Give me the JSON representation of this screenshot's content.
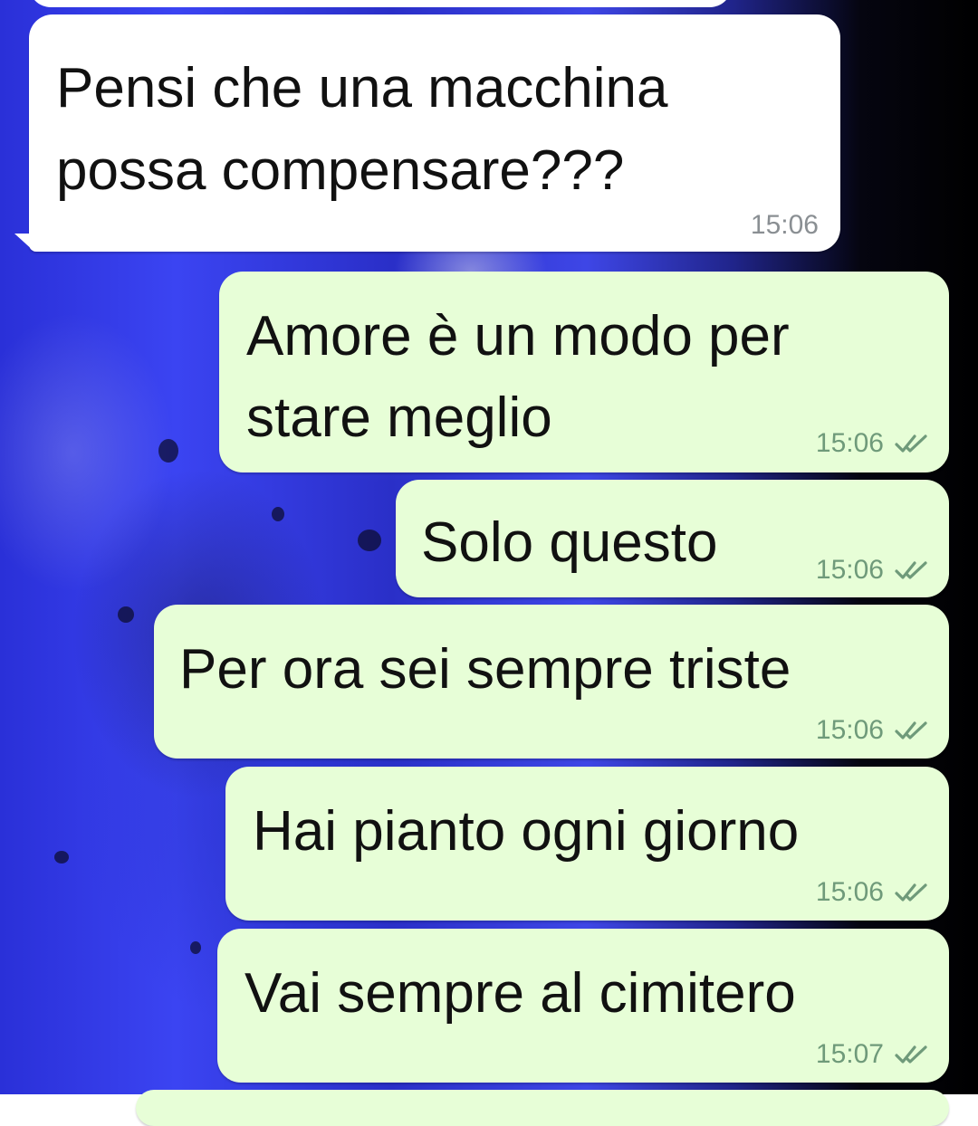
{
  "messages": [
    {
      "direction": "incoming",
      "lines": [
        "Pensi che una macchina",
        "possa compensare???"
      ],
      "time": "15:06",
      "status": null
    },
    {
      "direction": "outgoing",
      "lines": [
        "Amore è un modo per",
        "stare meglio"
      ],
      "time": "15:06",
      "status": "read-double-check-icon"
    },
    {
      "direction": "outgoing",
      "lines": [
        "Solo questo"
      ],
      "time": "15:06",
      "status": "read-double-check-icon"
    },
    {
      "direction": "outgoing",
      "lines": [
        "Per ora sei sempre triste"
      ],
      "time": "15:06",
      "status": "read-double-check-icon"
    },
    {
      "direction": "outgoing",
      "lines": [
        "Hai pianto ogni giorno"
      ],
      "time": "15:06",
      "status": "read-double-check-icon"
    },
    {
      "direction": "outgoing",
      "lines": [
        "Vai sempre al cimitero"
      ],
      "time": "15:07",
      "status": "read-double-check-icon"
    }
  ],
  "colors": {
    "incoming_bubble": "#ffffff",
    "outgoing_bubble": "#e7fed7",
    "wallpaper_main": "#3b44f2",
    "wallpaper_dark": "#000000",
    "tick_color": "#6f9a7a"
  }
}
